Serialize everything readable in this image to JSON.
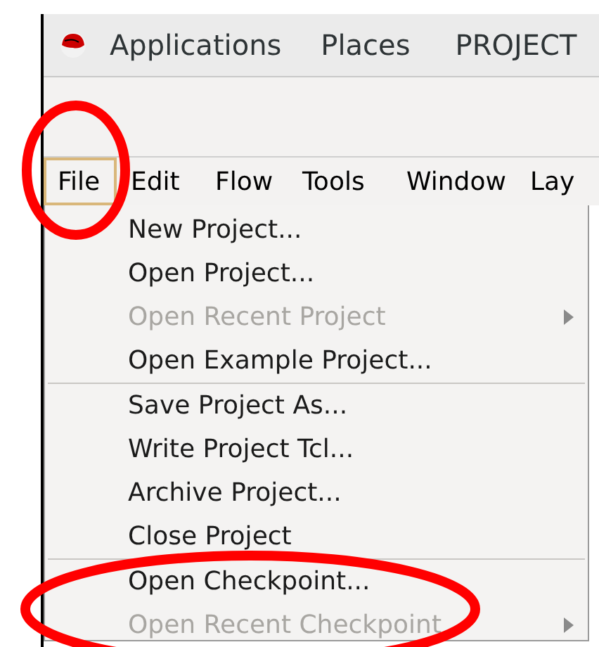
{
  "top_panel": {
    "items": [
      "Applications",
      "Places",
      "PROJECT"
    ]
  },
  "menubar": [
    {
      "label": "File",
      "selected": true
    },
    {
      "label": "Edit",
      "selected": false
    },
    {
      "label": "Flow",
      "selected": false
    },
    {
      "label": "Tools",
      "selected": false
    },
    {
      "label": "Window",
      "selected": false
    },
    {
      "label": "Lay",
      "selected": false
    }
  ],
  "menu": [
    {
      "kind": "item",
      "label": "New Project...",
      "disabled": false,
      "submenu": false
    },
    {
      "kind": "item",
      "label": "Open Project...",
      "disabled": false,
      "submenu": false
    },
    {
      "kind": "item",
      "label": "Open Recent Project",
      "disabled": true,
      "submenu": true
    },
    {
      "kind": "item",
      "label": "Open Example Project...",
      "disabled": false,
      "submenu": false
    },
    {
      "kind": "separator"
    },
    {
      "kind": "item",
      "label": "Save Project As...",
      "disabled": false,
      "submenu": false
    },
    {
      "kind": "item",
      "label": "Write Project Tcl...",
      "disabled": false,
      "submenu": false
    },
    {
      "kind": "item",
      "label": "Archive Project...",
      "disabled": false,
      "submenu": false
    },
    {
      "kind": "item",
      "label": "Close Project",
      "disabled": false,
      "submenu": false
    },
    {
      "kind": "separator"
    },
    {
      "kind": "item",
      "label": "Open Checkpoint...",
      "disabled": false,
      "submenu": false
    },
    {
      "kind": "item",
      "label": "Open Recent Checkpoint",
      "disabled": true,
      "submenu": true
    }
  ],
  "annotations": [
    {
      "kind": "ellipse",
      "color": "#ff0000"
    },
    {
      "kind": "ellipse",
      "color": "#ff0000"
    }
  ]
}
